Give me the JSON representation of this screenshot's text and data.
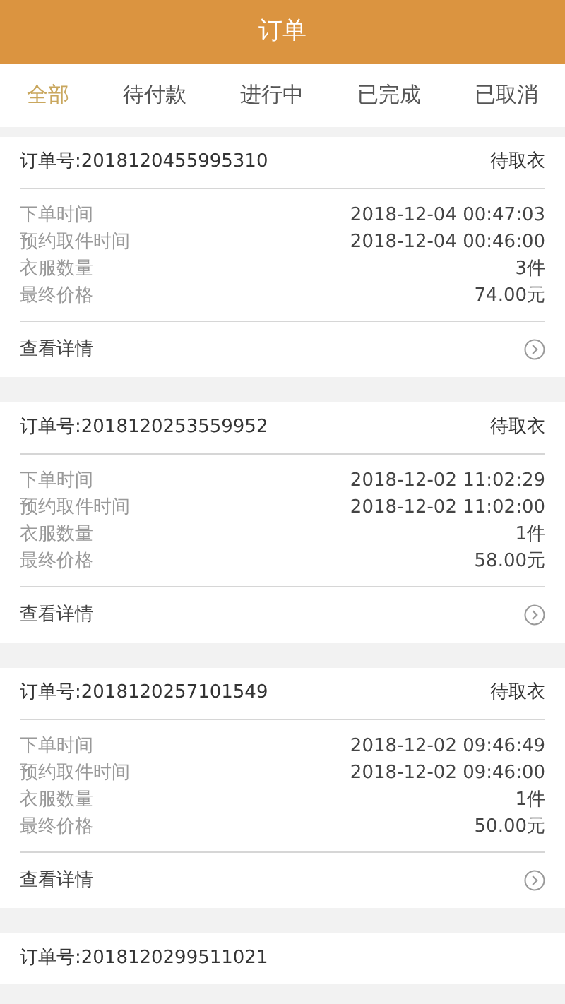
{
  "header": {
    "title": "订单"
  },
  "tabs": [
    {
      "label": "全部",
      "selected": true
    },
    {
      "label": "待付款",
      "selected": false
    },
    {
      "label": "进行中",
      "selected": false
    },
    {
      "label": "已完成",
      "selected": false
    },
    {
      "label": "已取消",
      "selected": false
    }
  ],
  "orders": [
    {
      "order_no": "订单号:2018120455995310",
      "status": "待取衣",
      "fields": [
        {
          "label": "下单时间",
          "value": "2018-12-04 00:47:03"
        },
        {
          "label": "预约取件时间",
          "value": "2018-12-04 00:46:00"
        },
        {
          "label": "衣服数量",
          "value": "3件"
        },
        {
          "label": "最终价格",
          "value": "74.00元"
        }
      ],
      "details_link": "查看详情"
    },
    {
      "order_no": "订单号:2018120253559952",
      "status": "待取衣",
      "fields": [
        {
          "label": "下单时间",
          "value": "2018-12-02 11:02:29"
        },
        {
          "label": "预约取件时间",
          "value": "2018-12-02 11:02:00"
        },
        {
          "label": "衣服数量",
          "value": "1件"
        },
        {
          "label": "最终价格",
          "value": "58.00元"
        }
      ],
      "details_link": "查看详情"
    },
    {
      "order_no": "订单号:2018120257101549",
      "status": "待取衣",
      "fields": [
        {
          "label": "下单时间",
          "value": "2018-12-02 09:46:49"
        },
        {
          "label": "预约取件时间",
          "value": "2018-12-02 09:46:00"
        },
        {
          "label": "衣服数量",
          "value": "1件"
        },
        {
          "label": "最终价格",
          "value": "50.00元"
        }
      ],
      "details_link": "查看详情"
    },
    {
      "order_no": "订单号:2018120299511021"
    }
  ]
}
